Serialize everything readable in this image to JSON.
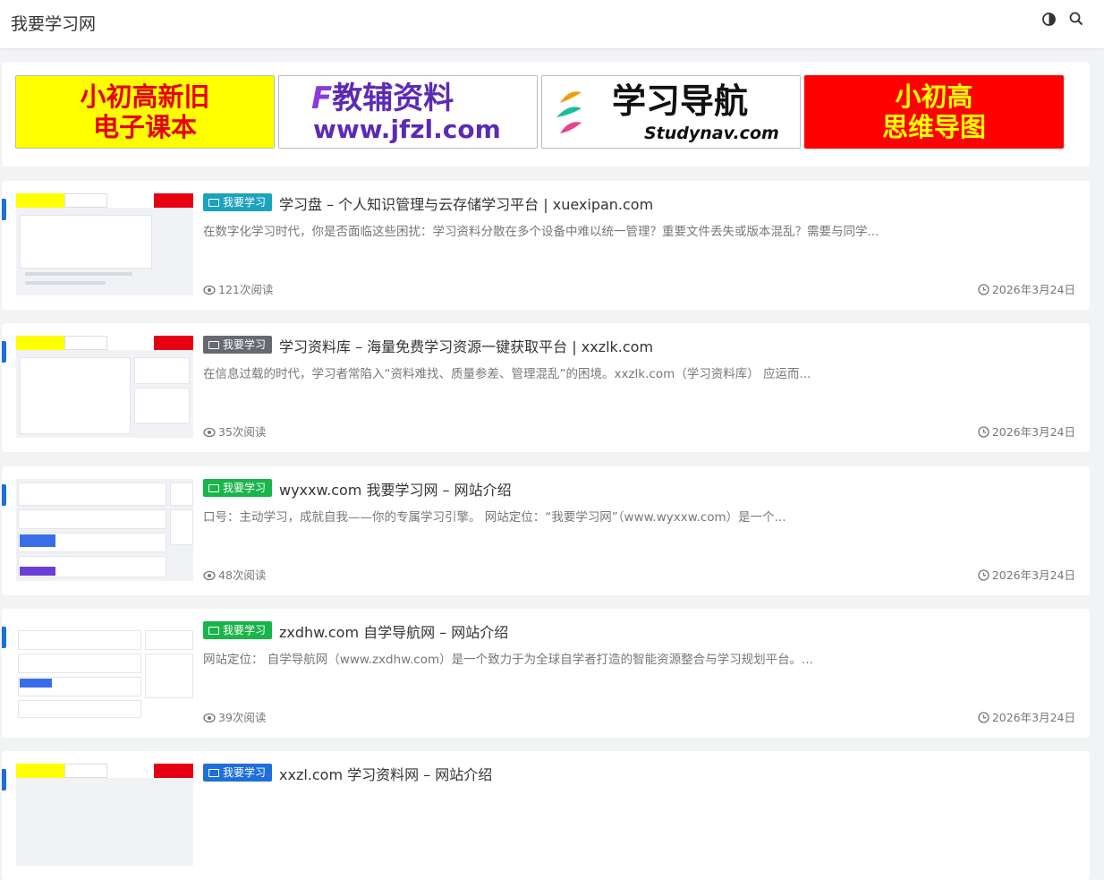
{
  "header": {
    "site_title": "我要学习网",
    "icons": [
      "contrast-icon",
      "search-icon"
    ]
  },
  "banners": [
    {
      "line1": "小初高新旧",
      "line2": "电子课本",
      "bg": "#ffff00",
      "fg": "#e60012"
    },
    {
      "line1": "教辅资料",
      "line2": "www.jfzl.com",
      "fg": "#5b2bb5"
    },
    {
      "line1": "学习导航",
      "line2": "Studynav.com",
      "fg": "#111111"
    },
    {
      "line1": "小初高",
      "line2": "思维导图",
      "bg": "#ff0000",
      "fg": "#ffff00"
    }
  ],
  "posts": [
    {
      "tag": "我要学习",
      "tag_color": "#1aa3bd",
      "title": "学习盘 – 个人知识管理与云存储学习平台 | xuexipan.com",
      "excerpt": "在数字化学习时代，你是否面临这些困扰：学习资料分散在多个设备中难以统一管理？重要文件丢失或版本混乱？需要与同学...",
      "views": "121次阅读",
      "date": "2026年3月24日"
    },
    {
      "tag": "我要学习",
      "tag_color": "#666a70",
      "title": "学习资料库 – 海量免费学习资源一键获取平台 | xxzlk.com",
      "excerpt": "在信息过载的时代，学习者常陷入“资料难找、质量参差、管理混乱”的困境。xxzlk.com（学习资料库） 应运而...",
      "views": "35次阅读",
      "date": "2026年3月24日"
    },
    {
      "tag": "我要学习",
      "tag_color": "#19b44a",
      "title": "wyxxw.com 我要学习网 – 网站介绍",
      "excerpt": "口号：主动学习，成就自我——你的专属学习引擎。 网站定位：“我要学习网”（www.wyxxw.com）是一个...",
      "views": "48次阅读",
      "date": "2026年3月24日"
    },
    {
      "tag": "我要学习",
      "tag_color": "#19b44a",
      "title": "zxdhw.com 自学导航网 – 网站介绍",
      "excerpt": "网站定位： 自学导航网（www.zxdhw.com）是一个致力于为全球自学者打造的智能资源整合与学习规划平台。...",
      "views": "39次阅读",
      "date": "2026年3月24日"
    },
    {
      "tag": "我要学习",
      "tag_color": "#1e6fd9",
      "title": "xxzl.com 学习资料网 – 网站介绍",
      "excerpt": "",
      "views": "",
      "date": ""
    }
  ]
}
